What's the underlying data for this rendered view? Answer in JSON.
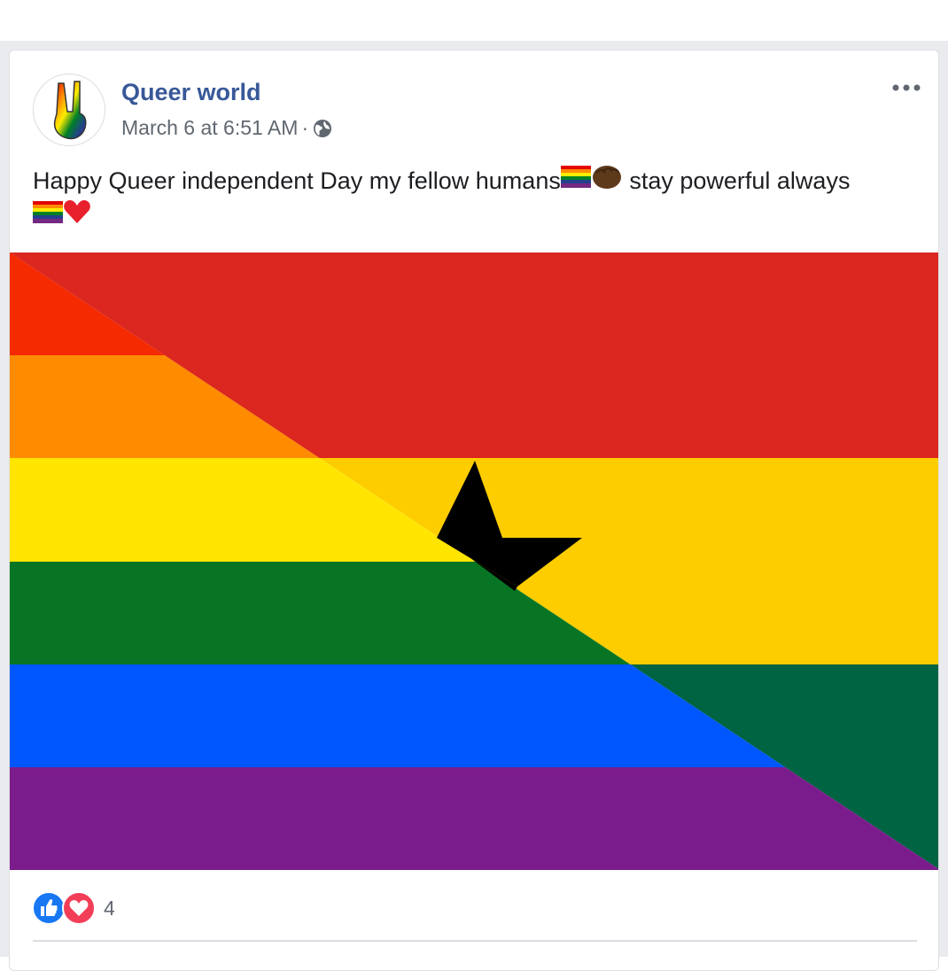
{
  "post": {
    "page_name": "Queer world",
    "timestamp": "March 6 at 6:51 AM",
    "separator": "·",
    "privacy_icon": "globe-icon",
    "more_icon": "more-options-icon",
    "text_line1": "Happy Queer independent Day my fellow humans",
    "text_after_emoji": " stay powerful always",
    "emojis": [
      "rainbow-flag-emoji",
      "raised-fist-emoji",
      "rainbow-flag-emoji",
      "red-heart-emoji"
    ],
    "image_description_icon": "ghana-pride-flag-image"
  },
  "reactions": {
    "icons": [
      "like-icon",
      "love-icon"
    ],
    "count": "4"
  },
  "colors": {
    "link_blue": "#385898",
    "meta_gray": "#606770",
    "text_dark": "#1c1e21",
    "feed_bg": "#e9ebee",
    "like_blue": "#1877f2",
    "love_red": "#f33e58"
  }
}
